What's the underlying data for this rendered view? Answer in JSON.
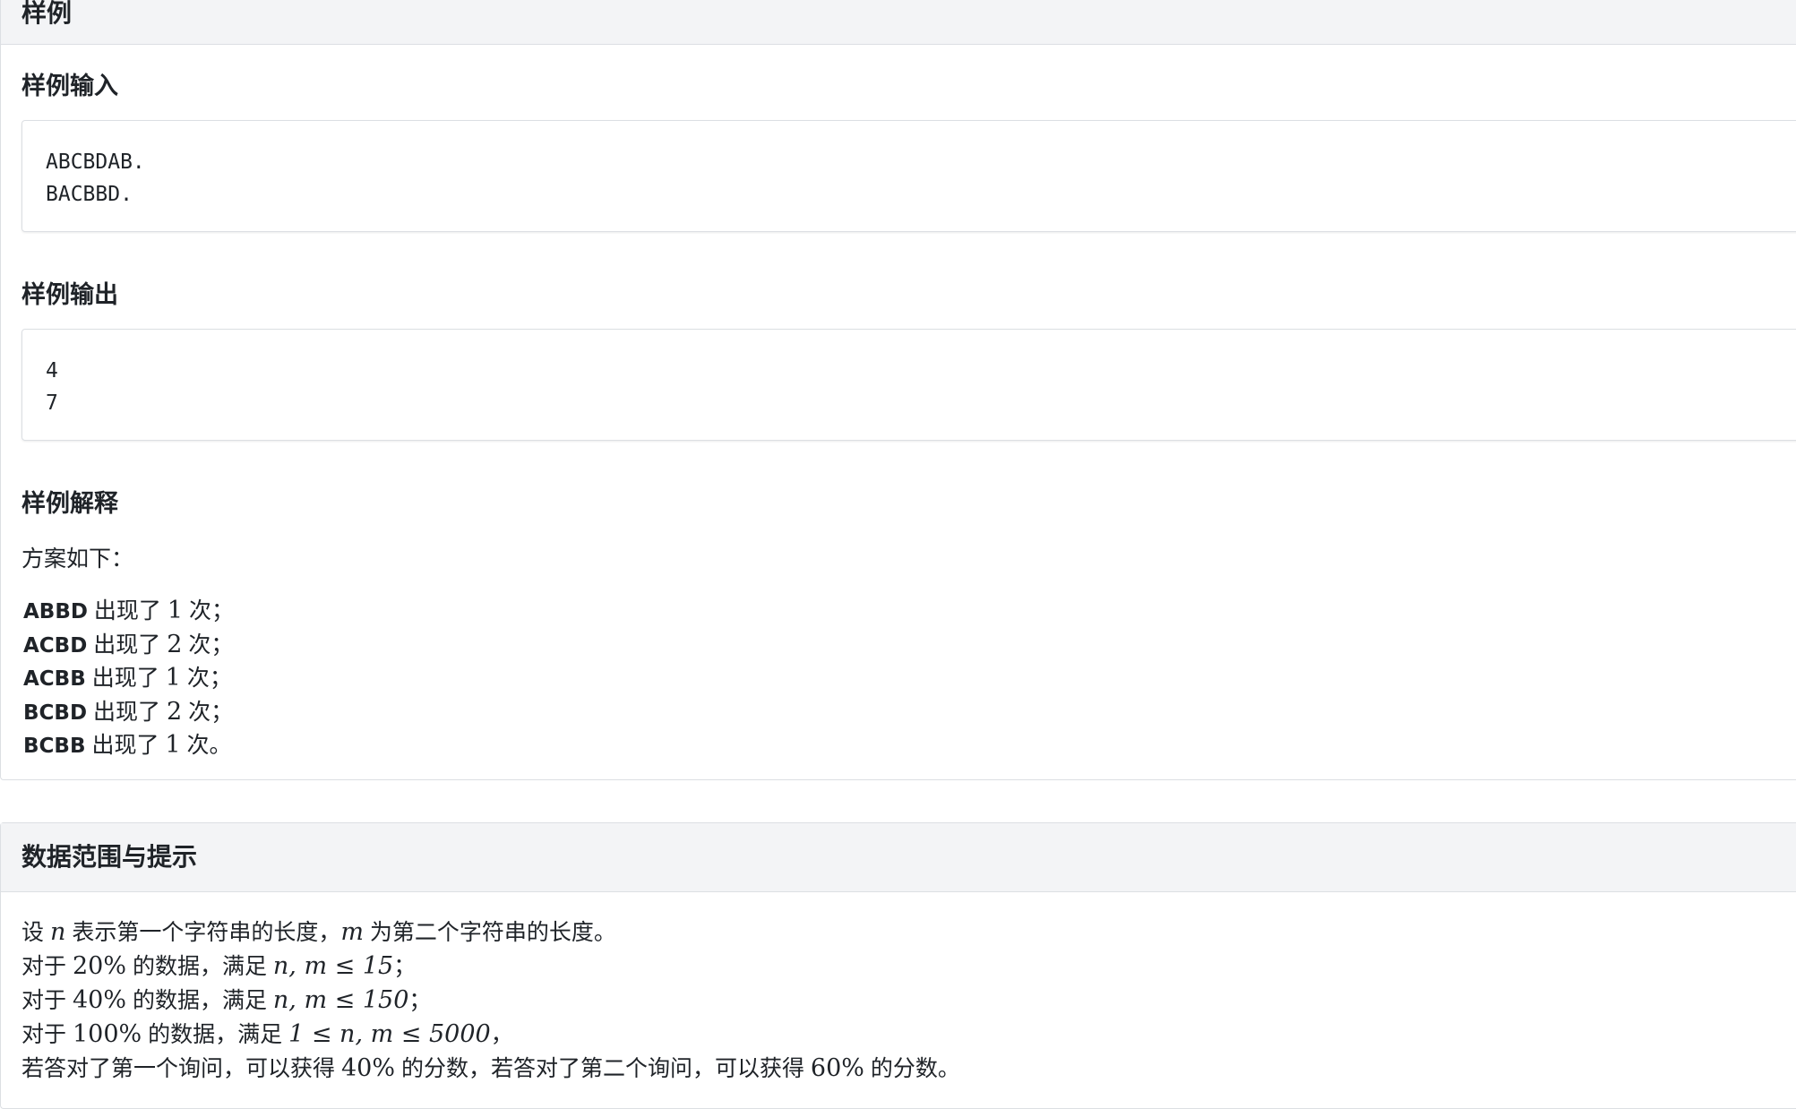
{
  "sample_section": {
    "header": "样例",
    "input_heading": "样例输入",
    "input_lines": [
      "ABCBDAB.",
      "BACBBD."
    ],
    "output_heading": "样例输出",
    "output_lines": [
      "4",
      "7"
    ],
    "explain_heading": "样例解释",
    "explain_intro": "方案如下：",
    "explain_rows": [
      {
        "seq": "ABBD",
        "pre": "出现了",
        "count": "1",
        "post": "次；"
      },
      {
        "seq": "ACBD",
        "pre": "出现了",
        "count": "2",
        "post": "次；"
      },
      {
        "seq": "ACBB",
        "pre": "出现了",
        "count": "1",
        "post": "次；"
      },
      {
        "seq": "BCBD",
        "pre": "出现了",
        "count": "2",
        "post": "次；"
      },
      {
        "seq": "BCBB",
        "pre": "出现了",
        "count": "1",
        "post": "次。"
      }
    ]
  },
  "hints_section": {
    "header": "数据范围与提示",
    "line1": {
      "a": "设",
      "n": "n",
      "b": "表示第一个字符串的长度，",
      "m": "m",
      "c": "为第二个字符串的长度。"
    },
    "line2": {
      "a": "对于",
      "pct": "20%",
      "b": "的数据，满足",
      "expr": "n, m ≤ 15",
      "c": "；"
    },
    "line3": {
      "a": "对于",
      "pct": "40%",
      "b": "的数据，满足",
      "expr": "n, m ≤ 150",
      "c": "；"
    },
    "line4": {
      "a": "对于",
      "pct": "100%",
      "b": "的数据，满足",
      "expr": "1 ≤ n, m ≤ 5000",
      "c": "，"
    },
    "line5": {
      "a": "若答对了第一个询问，可以获得",
      "pct1": "40%",
      "b": "的分数，若答对了第二个询问，可以获得",
      "pct2": "60%",
      "c": "的分数。"
    }
  }
}
